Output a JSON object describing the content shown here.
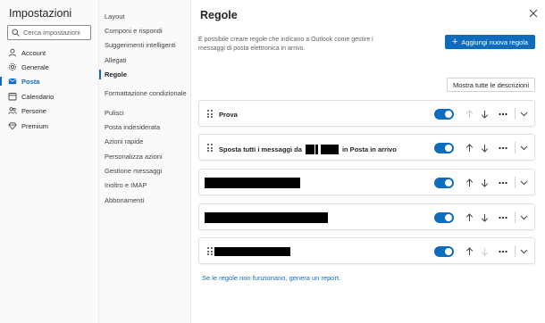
{
  "app_title": "Impostazioni",
  "search": {
    "placeholder": "Cerca impostazioni"
  },
  "categories": [
    {
      "label": "Account",
      "icon": "person-icon"
    },
    {
      "label": "Generale",
      "icon": "gear-icon"
    },
    {
      "label": "Posta",
      "icon": "mail-icon",
      "active": true
    },
    {
      "label": "Calendario",
      "icon": "calendar-icon"
    },
    {
      "label": "Persone",
      "icon": "people-icon"
    },
    {
      "label": "Premium",
      "icon": "diamond-icon"
    }
  ],
  "subnav": {
    "items": [
      "Layout",
      "Componi e rispondi",
      "Suggerimenti intelligenti",
      "Allegati",
      "Regole",
      "Formattazione condizionale",
      "Pulisci",
      "Posta indesiderata",
      "Azioni rapide",
      "Personalizza azioni",
      "Gestione messaggi",
      "Inoltro e IMAP",
      "Abbonamenti"
    ],
    "active": "Regole"
  },
  "main": {
    "title": "Regole",
    "description": "È possibile creare regole che indicano a Outlook come gestire i messaggi di posta elettronica in arrivo.",
    "add_button": "Aggiungi nuova regola",
    "show_descriptions_button": "Mostra tutte le descrizioni",
    "report_link": "Se le regole non funzionano, genera un report.",
    "rules": [
      {
        "name": "Prova",
        "enabled": true
      },
      {
        "name_before": "Sposta tutti i messaggi da",
        "name_after": "in Posta in arrivo",
        "enabled": true,
        "redacted": true
      },
      {
        "name": "",
        "enabled": true,
        "redacted": true
      },
      {
        "name": "",
        "enabled": true,
        "redacted": true
      },
      {
        "name": "",
        "enabled": true,
        "redacted": true
      }
    ]
  },
  "colors": {
    "accent": "#0f6cbd"
  }
}
